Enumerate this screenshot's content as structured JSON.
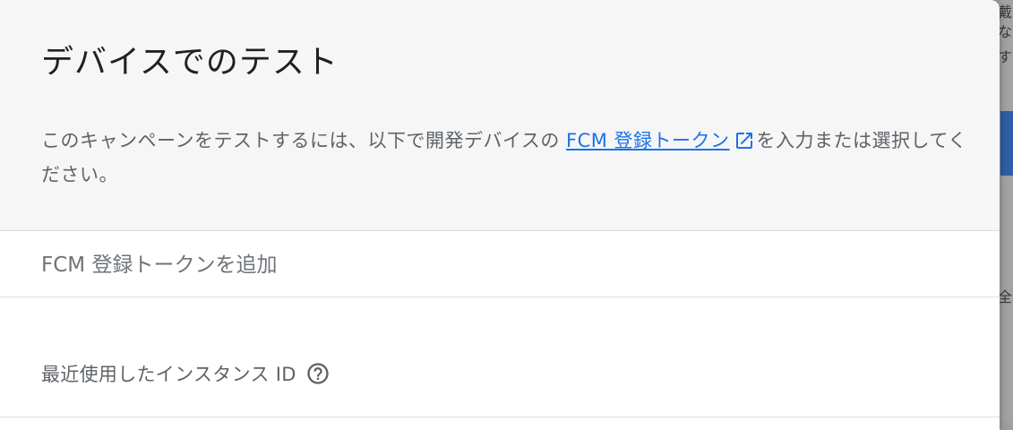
{
  "dialog": {
    "title": "デバイスでのテスト",
    "description_before": "このキャンペーンをテストするには、以下で開発デバイスの ",
    "link_text": "FCM 登録トークン",
    "description_after": "を入力または選択してください。"
  },
  "token_input": {
    "placeholder": "FCM 登録トークンを追加",
    "value": ""
  },
  "recent": {
    "label": "最近使用したインスタンス ID"
  },
  "icons": {
    "external": "open-in-new-icon",
    "help": "help-circle-icon"
  },
  "background": {
    "glyphs": [
      "戴",
      "な",
      "す",
      "全"
    ]
  },
  "colors": {
    "link": "#1a73e8",
    "text_secondary": "#5f6368",
    "title": "#212121"
  }
}
